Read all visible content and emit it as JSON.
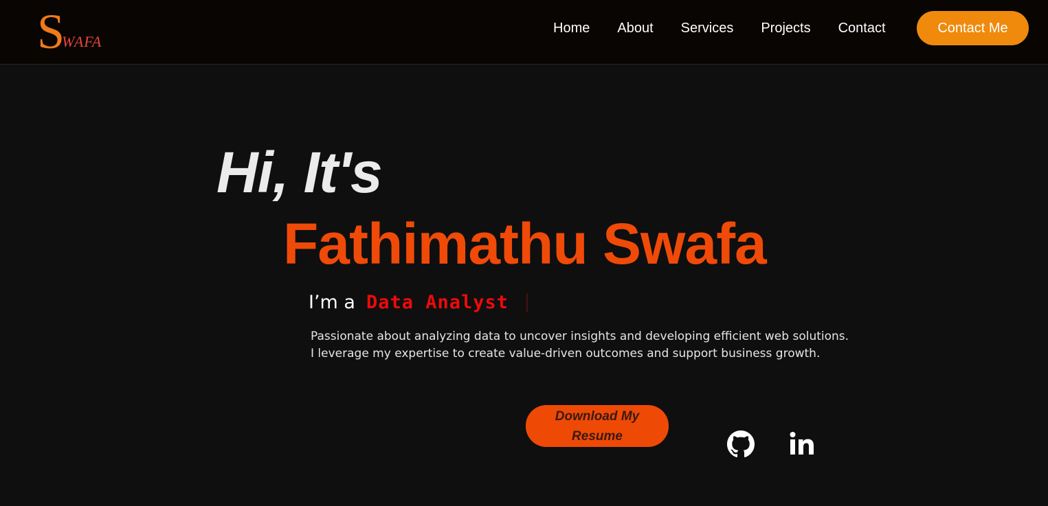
{
  "logo": {
    "initial": "S",
    "rest": "WAFA"
  },
  "nav": {
    "items": [
      {
        "label": "Home"
      },
      {
        "label": "About"
      },
      {
        "label": "Services"
      },
      {
        "label": "Projects"
      },
      {
        "label": "Contact"
      }
    ],
    "cta_label": "Contact Me"
  },
  "hero": {
    "greeting": "Hi, It's",
    "name": "Fathimathu Swafa",
    "role_prefix": "I’m a",
    "role": "Data Analyst",
    "description": [
      "Passionate about analyzing data to uncover insights and developing efficient web solutions.",
      "I leverage my expertise to create value-driven outcomes and support business growth."
    ],
    "resume_label": "Download My Resume"
  },
  "social": {
    "github_icon": "github-icon",
    "linkedin_icon": "linkedin-icon"
  },
  "colors": {
    "accent_orange": "#ef8a0c",
    "name_orange": "#f04a08",
    "role_red": "#ee0a0a",
    "background": "#0f0f0f",
    "navbar": "#080502"
  }
}
